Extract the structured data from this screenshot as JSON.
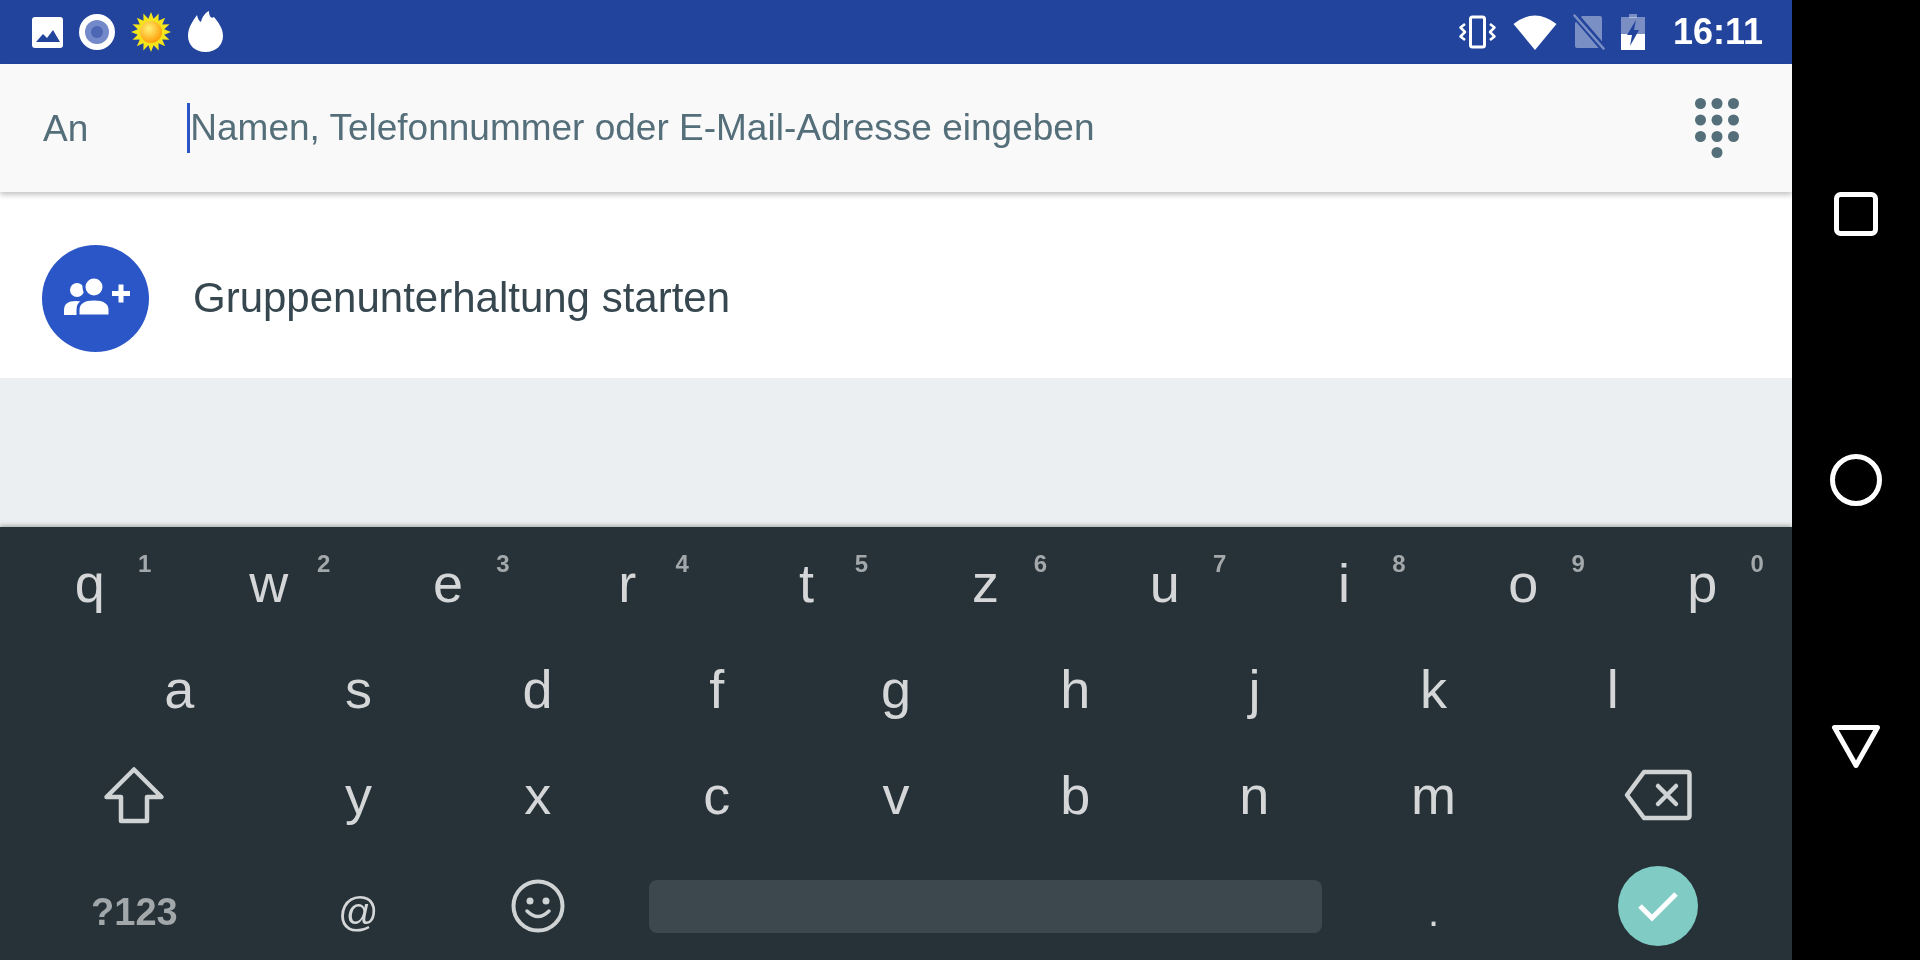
{
  "status_bar": {
    "time": "16:11"
  },
  "recipient_bar": {
    "label": "An",
    "placeholder": "Namen, Telefonnummer oder E-Mail-Adresse eingeben",
    "focused": true
  },
  "suggestions": [
    {
      "label": "Gruppenunterhaltung starten"
    }
  ],
  "keyboard": {
    "rows": [
      {
        "keys": [
          {
            "kind": "letter",
            "label": "q",
            "hint": "1"
          },
          {
            "kind": "letter",
            "label": "w",
            "hint": "2"
          },
          {
            "kind": "letter",
            "label": "e",
            "hint": "3"
          },
          {
            "kind": "letter",
            "label": "r",
            "hint": "4"
          },
          {
            "kind": "letter",
            "label": "t",
            "hint": "5"
          },
          {
            "kind": "letter",
            "label": "z",
            "hint": "6"
          },
          {
            "kind": "letter",
            "label": "u",
            "hint": "7"
          },
          {
            "kind": "letter",
            "label": "i",
            "hint": "8"
          },
          {
            "kind": "letter",
            "label": "o",
            "hint": "9"
          },
          {
            "kind": "letter",
            "label": "p",
            "hint": "0"
          }
        ]
      },
      {
        "keys": [
          {
            "kind": "letter",
            "label": "a"
          },
          {
            "kind": "letter",
            "label": "s"
          },
          {
            "kind": "letter",
            "label": "d"
          },
          {
            "kind": "letter",
            "label": "f"
          },
          {
            "kind": "letter",
            "label": "g"
          },
          {
            "kind": "letter",
            "label": "h"
          },
          {
            "kind": "letter",
            "label": "j"
          },
          {
            "kind": "letter",
            "label": "k"
          },
          {
            "kind": "letter",
            "label": "l"
          }
        ]
      },
      {
        "keys": [
          {
            "kind": "shift"
          },
          {
            "kind": "letter",
            "label": "y"
          },
          {
            "kind": "letter",
            "label": "x"
          },
          {
            "kind": "letter",
            "label": "c"
          },
          {
            "kind": "letter",
            "label": "v"
          },
          {
            "kind": "letter",
            "label": "b"
          },
          {
            "kind": "letter",
            "label": "n"
          },
          {
            "kind": "letter",
            "label": "m"
          },
          {
            "kind": "backspace"
          }
        ]
      },
      {
        "keys": [
          {
            "kind": "symbols",
            "label": "?123"
          },
          {
            "kind": "symbol",
            "label": "@"
          },
          {
            "kind": "emoji"
          },
          {
            "kind": "space"
          },
          {
            "kind": "symbol",
            "label": "."
          },
          {
            "kind": "enter"
          }
        ]
      }
    ]
  }
}
